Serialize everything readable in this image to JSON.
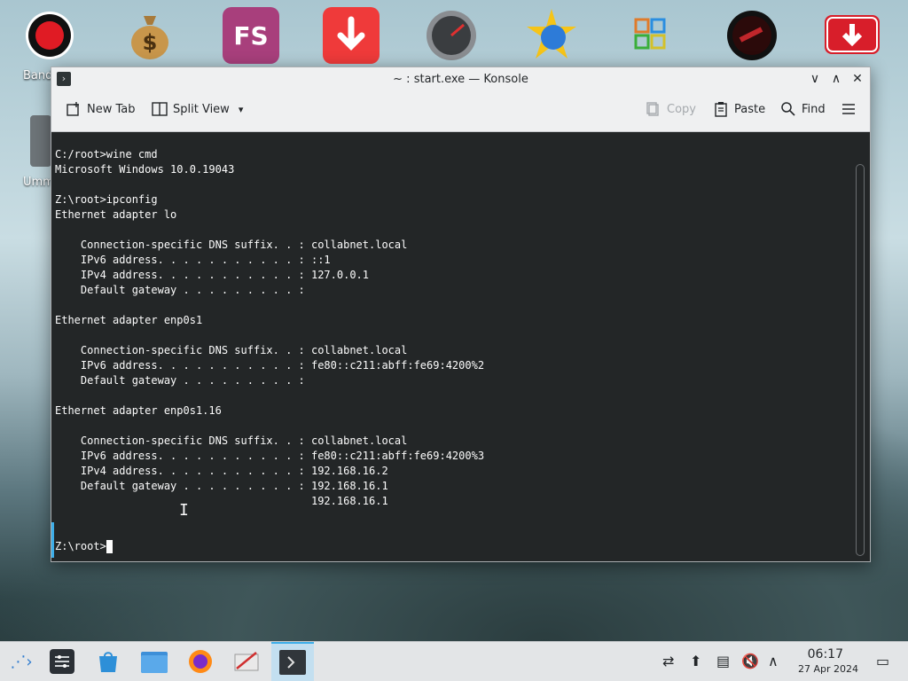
{
  "desktop": {
    "icons": [
      {
        "name": "record-app-icon",
        "glyph": "●"
      },
      {
        "name": "money-bag-icon",
        "glyph": "$"
      },
      {
        "name": "fs-app-icon",
        "glyph": "FS"
      },
      {
        "name": "download-app-icon",
        "glyph": "↓"
      },
      {
        "name": "speedometer-icon",
        "glyph": "◔"
      },
      {
        "name": "star-globe-icon",
        "glyph": "✸"
      },
      {
        "name": "office-grid-icon",
        "glyph": "▦"
      },
      {
        "name": "dark-disc-icon",
        "glyph": "◉"
      },
      {
        "name": "red-download-icon",
        "glyph": "⬇"
      }
    ],
    "labels": {
      "band": "Band",
      "umm": "Umm"
    }
  },
  "window": {
    "title": "~ : start.exe — Konsole",
    "controls": {
      "minimize": "∨",
      "maximize": "∧",
      "close": "✕"
    }
  },
  "toolbar": {
    "new_tab": "New Tab",
    "split_view": "Split View",
    "copy": "Copy",
    "paste": "Paste",
    "find": "Find"
  },
  "terminal": {
    "output": "C:/root>wine cmd\nMicrosoft Windows 10.0.19043\n\nZ:\\root>ipconfig\nEthernet adapter lo\n\n    Connection-specific DNS suffix. . : collabnet.local\n    IPv6 address. . . . . . . . . . . : ::1\n    IPv4 address. . . . . . . . . . . : 127.0.0.1\n    Default gateway . . . . . . . . . :\n\nEthernet adapter enp0s1\n\n    Connection-specific DNS suffix. . : collabnet.local\n    IPv6 address. . . . . . . . . . . : fe80::c211:abff:fe69:4200%2\n    Default gateway . . . . . . . . . :\n\nEthernet adapter enp0s1.16\n\n    Connection-specific DNS suffix. . : collabnet.local\n    IPv6 address. . . . . . . . . . . : fe80::c211:abff:fe69:4200%3\n    IPv4 address. . . . . . . . . . . : 192.168.16.2\n    Default gateway . . . . . . . . . : 192.168.16.1\n                                        192.168.16.1",
    "prompt": "Z:\\root>"
  },
  "taskbar": {
    "launcher": "⋰›",
    "tasks": [
      {
        "name": "settings-task-icon",
        "glyph": "☰"
      },
      {
        "name": "store-task-icon",
        "glyph": "🛍"
      },
      {
        "name": "files-task-icon",
        "glyph": "▭"
      },
      {
        "name": "firefox-task-icon",
        "glyph": "◍"
      },
      {
        "name": "editor-task-icon",
        "glyph": "✎"
      },
      {
        "name": "konsole-task-icon",
        "glyph": ">"
      }
    ],
    "tray": {
      "network": "⇄",
      "updates": "⬆",
      "clipboard": "▤",
      "volume": "🔇",
      "expand": "∧",
      "desktop": "▭"
    },
    "clock": {
      "time": "06:17",
      "date": "27 Apr 2024"
    }
  },
  "colors": {
    "accent": "#3daee9",
    "terminal_bg": "#232627",
    "terminal_fg": "#fcfcfc",
    "window_bg": "#eff0f1"
  }
}
